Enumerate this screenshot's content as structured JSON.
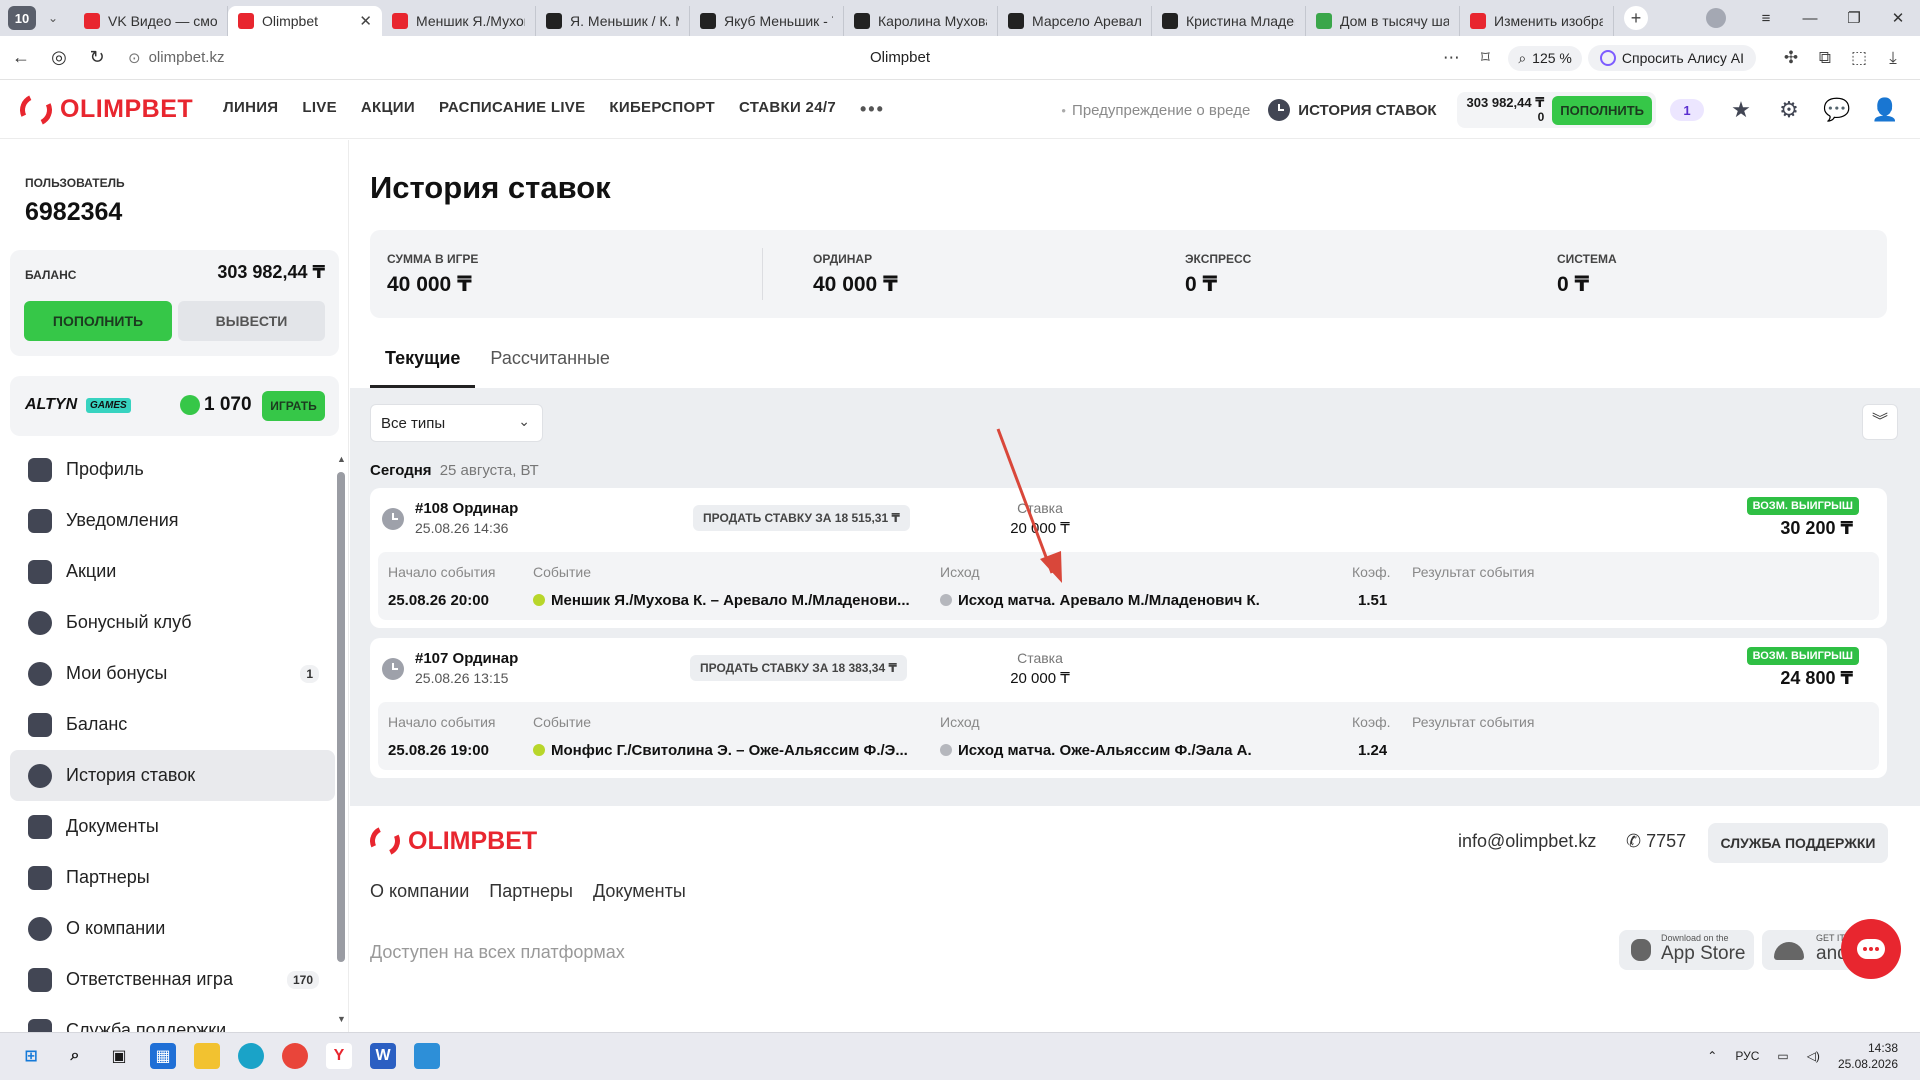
{
  "browser": {
    "tab_count": "10",
    "tabs": [
      {
        "title": "VK Видео — смот",
        "fav_color": "#e8262f",
        "active": false
      },
      {
        "title": "Olimpbet",
        "fav_color": "#e8262f",
        "active": true
      },
      {
        "title": "Меншик Я./Мухов",
        "fav_color": "#e8262f",
        "active": false
      },
      {
        "title": "Я. Меньшик / К. М",
        "fav_color": "#222",
        "active": false
      },
      {
        "title": "Якуб Меньшик - Т",
        "fav_color": "#222",
        "active": false
      },
      {
        "title": "Каролина Мухова",
        "fav_color": "#222",
        "active": false
      },
      {
        "title": "Марсело Аревало",
        "fav_color": "#222",
        "active": false
      },
      {
        "title": "Кристина Младен",
        "fav_color": "#222",
        "active": false
      },
      {
        "title": "Дом в тысячу шаг",
        "fav_color": "#3aa64a",
        "active": false
      },
      {
        "title": "Изменить изобра",
        "fav_color": "#e8262f",
        "active": false
      }
    ],
    "url": "olimpbet.kz",
    "page_title": "Olimpbet",
    "zoom": "125 %",
    "alice_label": "Спросить Алису AI"
  },
  "header": {
    "logo": "OLIMPBET",
    "nav": [
      "ЛИНИЯ",
      "LIVE",
      "АКЦИИ",
      "РАСПИСАНИЕ LIVE",
      "КИБЕРСПОРТ",
      "СТАВКИ 24/7"
    ],
    "more": "•••",
    "warning": "Предупреждение о вреде",
    "history": "ИСТОРИЯ СТАВОК",
    "balance": "303 982,44 ₸",
    "bonus_balance": "0",
    "deposit": "ПОПОЛНИТЬ",
    "promo_count": "1"
  },
  "sidebar": {
    "user_label": "ПОЛЬЗОВАТЕЛЬ",
    "user_id": "6982364",
    "balance_label": "БАЛАНС",
    "balance_value": "303 982,44 ₸",
    "deposit": "ПОПОЛНИТЬ",
    "withdraw": "ВЫВЕСТИ",
    "altyn": "ALTYN",
    "altyn_games": "GAMES",
    "altyn_points": "1 070",
    "play": "ИГРАТЬ",
    "menu": [
      {
        "label": "Профиль",
        "badge": ""
      },
      {
        "label": "Уведомления",
        "badge": ""
      },
      {
        "label": "Акции",
        "badge": ""
      },
      {
        "label": "Бонусный клуб",
        "badge": ""
      },
      {
        "label": "Мои бонусы",
        "badge": "1"
      },
      {
        "label": "Баланс",
        "badge": ""
      },
      {
        "label": "История ставок",
        "badge": "",
        "active": true
      },
      {
        "label": "Документы",
        "badge": ""
      },
      {
        "label": "Партнеры",
        "badge": ""
      },
      {
        "label": "О компании",
        "badge": ""
      },
      {
        "label": "Ответственная игра",
        "badge": "170"
      },
      {
        "label": "Служба поддержки",
        "badge": ""
      }
    ]
  },
  "main": {
    "title": "История ставок",
    "stats": [
      {
        "label": "СУММА В ИГРЕ",
        "value": "40 000 ₸"
      },
      {
        "label": "ОРДИНАР",
        "value": "40 000 ₸"
      },
      {
        "label": "ЭКСПРЕСС",
        "value": "0 ₸"
      },
      {
        "label": "СИСТЕМА",
        "value": "0 ₸"
      }
    ],
    "tabs": [
      "Текущие",
      "Рассчитанные"
    ],
    "filter": "Все типы",
    "day_label": "Сегодня",
    "day_date": "25 августа, ВТ",
    "bets": [
      {
        "id": "#108 Ординар",
        "date": "25.08.26 14:36",
        "sell": "ПРОДАТЬ СТАВКУ ЗА 18 515,31 ₸",
        "stake_label": "Ставка",
        "stake": "20 000 ₸",
        "win_label": "ВОЗМ. ВЫИГРЫШ",
        "win": "30 200 ₸",
        "headers": [
          "Начало события",
          "Событие",
          "Исход",
          "Коэф.",
          "Результат события"
        ],
        "start": "25.08.26 20:00",
        "event": "Меншик Я./Мухова К. – Аревало М./Младенови...",
        "outcome": "Исход матча. Аревало М./Младенович К.",
        "coef": "1.51",
        "result": ""
      },
      {
        "id": "#107 Ординар",
        "date": "25.08.26 13:15",
        "sell": "ПРОДАТЬ СТАВКУ ЗА 18 383,34 ₸",
        "stake_label": "Ставка",
        "stake": "20 000 ₸",
        "win_label": "ВОЗМ. ВЫИГРЫШ",
        "win": "24 800 ₸",
        "headers": [
          "Начало события",
          "Событие",
          "Исход",
          "Коэф.",
          "Результат события"
        ],
        "start": "25.08.26 19:00",
        "event": "Монфис Г./Свитолина Э. – Оже-Альяссим Ф./Э...",
        "outcome": "Исход матча. Оже-Альяссим Ф./Эала А.",
        "coef": "1.24",
        "result": ""
      }
    ]
  },
  "footer": {
    "logo": "OLIMPBET",
    "email": "info@olimpbet.kz",
    "phone": "7757",
    "support": "СЛУЖБА ПОДДЕРЖКИ",
    "links": [
      "О компании",
      "Партнеры",
      "Документы"
    ],
    "available": "Доступен на всех платформах",
    "appstore_small": "Download on the",
    "appstore": "App Store",
    "android_small": "GET IT ON",
    "android": "android"
  },
  "taskbar": {
    "lang": "РУС",
    "time": "14:38",
    "date": "25.08.2026"
  },
  "colors": {
    "brand_red": "#e8262f",
    "green": "#36c748",
    "dark_icon": "#424654"
  }
}
